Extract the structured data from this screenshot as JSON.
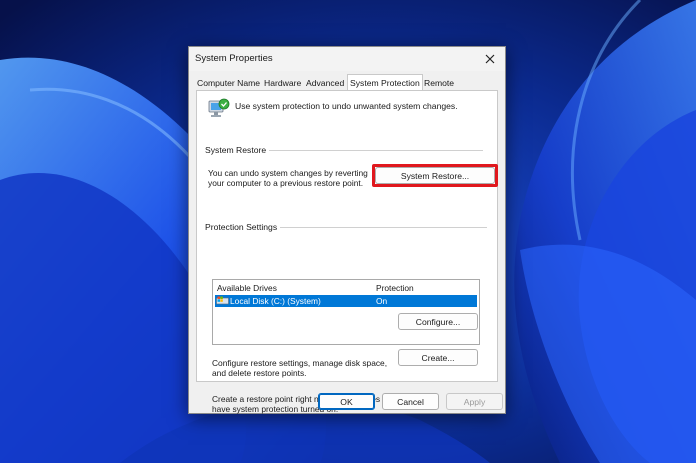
{
  "window": {
    "title": "System Properties"
  },
  "tabs": [
    {
      "label": "Computer Name"
    },
    {
      "label": "Hardware"
    },
    {
      "label": "Advanced"
    },
    {
      "label": "System Protection",
      "active": true
    },
    {
      "label": "Remote"
    }
  ],
  "intro_text": "Use system protection to undo unwanted system changes.",
  "system_restore": {
    "heading": "System Restore",
    "description": "You can undo system changes by reverting your computer to a previous restore point.",
    "button_label": "System Restore...",
    "highlight_color": "#e0181e"
  },
  "protection_settings": {
    "heading": "Protection Settings",
    "columns": [
      "Available Drives",
      "Protection"
    ],
    "drives": [
      {
        "name": "Local Disk (C:) (System)",
        "protection": "On",
        "selected": true
      }
    ],
    "configure_text": "Configure restore settings, manage disk space, and delete restore points.",
    "configure_button": "Configure...",
    "create_text": "Create a restore point right now for the drives that have system protection turned on.",
    "create_button": "Create..."
  },
  "footer": {
    "ok_label": "OK",
    "cancel_label": "Cancel",
    "apply_label": "Apply",
    "apply_enabled": false
  },
  "icons": {
    "close": "close-icon",
    "system_protection": "system-protection-icon",
    "drive": "drive-icon"
  },
  "colors": {
    "selection": "#0078d7",
    "wallpaper": "#0a1a55",
    "dialog_bg": "#f0f0f0"
  }
}
